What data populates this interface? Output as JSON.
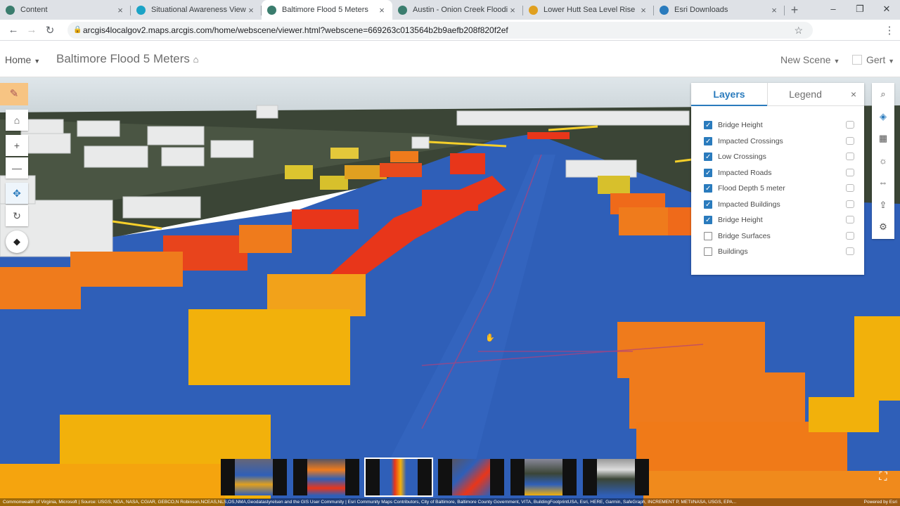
{
  "browser": {
    "tabs": [
      {
        "title": "Content",
        "color": "#3b7d6e"
      },
      {
        "title": "Situational Awareness Viewer",
        "color": "#1ba3c6"
      },
      {
        "title": "Baltimore Flood 5 Meters",
        "color": "#3b7d6e",
        "active": true
      },
      {
        "title": "Austin - Onion Creek Flooding",
        "color": "#3b7d6e"
      },
      {
        "title": "Lower Hutt Sea Level Rise",
        "color": "#e0a020"
      },
      {
        "title": "Esri Downloads",
        "color": "#2a7bbd"
      }
    ],
    "new_tab": "+",
    "url": "arcgis4localgov2.maps.arcgis.com/home/webscene/viewer.html?webscene=669263c013564b2b9aefb208f820f2ef"
  },
  "header": {
    "home_label": "Home",
    "scene_title": "Baltimore Flood 5 Meters",
    "new_scene_label": "New Scene",
    "user_name": "Gert"
  },
  "panel": {
    "tab_layers": "Layers",
    "tab_legend": "Legend",
    "close": "×",
    "layers": [
      {
        "name": "Bridge Height",
        "checked": true
      },
      {
        "name": "Impacted Crossings",
        "checked": true
      },
      {
        "name": "Low Crossings",
        "checked": true
      },
      {
        "name": "Impacted Roads",
        "checked": true
      },
      {
        "name": "Flood Depth 5 meter",
        "checked": true
      },
      {
        "name": "Impacted Buildings",
        "checked": true
      },
      {
        "name": "Bridge Height",
        "checked": true
      },
      {
        "name": "Bridge Surfaces",
        "checked": false
      },
      {
        "name": "Buildings",
        "checked": false
      }
    ]
  },
  "attribution": "Commonwealth of Virginia, Microsoft | Source: USGS, NGA, NASA, CGIAR, GEBCO,N Robinson,NCEAS,NLS,OS,NMA,Geodatastyrelsen and the GIS User Community | Esri Community Maps Contributors, City of Baltimore, Baltimore County Government, VITA, BuildingFootprintUSA, Esri, HERE, Garmin, SafeGraph, INCREMENT P, METI/NASA, USGS, EPA...",
  "powered_by": "Powered by Esri",
  "colors": {
    "water": "#2f5fb8",
    "accent": "#2a7bbd",
    "impacted_high": "#e8361a",
    "impacted_mid": "#ef7b1c",
    "impacted_low": "#f2b10b"
  }
}
